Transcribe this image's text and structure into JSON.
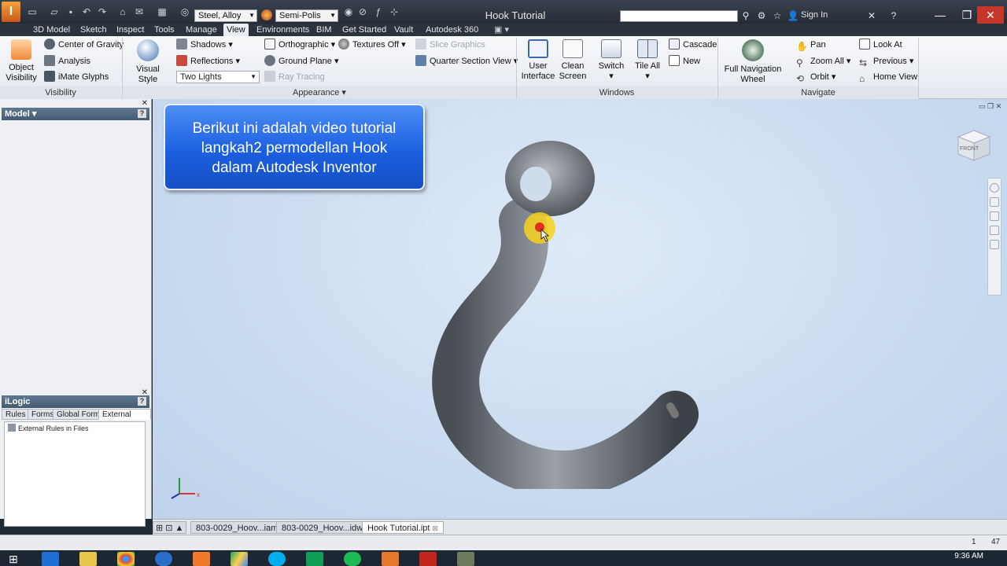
{
  "titlebar": {
    "material": "Steel, Alloy",
    "appearance": "Semi-Polis",
    "title": "Hook Tutorial",
    "signin": "Sign In"
  },
  "menu_tabs": [
    "3D Model",
    "Sketch",
    "Inspect",
    "Tools",
    "Manage",
    "View",
    "Environments",
    "BIM",
    "Get Started",
    "Vault",
    "Autodesk 360"
  ],
  "active_tab": "View",
  "ribbon": {
    "visibility": {
      "object_visibility": "Object Visibility",
      "object_visibility_l1": "Object",
      "object_visibility_l2": "Visibility",
      "center_of_gravity": "Center of Gravity",
      "analysis": "Analysis",
      "imate_glyphs": "iMate Glyphs",
      "panel_label": "Visibility"
    },
    "appearance": {
      "visual_style": "Visual Style",
      "shadows": "Shadows",
      "reflections": "Reflections",
      "lighting": "Two Lights",
      "orthographic": "Orthographic",
      "ground_plane": "Ground Plane",
      "ray_tracing": "Ray Tracing",
      "textures": "Textures Off",
      "slice_graphics": "Slice Graphics",
      "quarter_section": "Quarter Section View",
      "panel_label": "Appearance"
    },
    "windows": {
      "user_interface_l1": "User",
      "user_interface_l2": "Interface",
      "clean_screen_l1": "Clean",
      "clean_screen_l2": "Screen",
      "switch": "Switch",
      "tile_all": "Tile All",
      "cascade": "Cascade",
      "new": "New",
      "panel_label": "Windows"
    },
    "navigate": {
      "full_nav_wheel_l1": "Full Navigation",
      "full_nav_wheel_l2": "Wheel",
      "pan": "Pan",
      "zoom_all": "Zoom All",
      "orbit": "Orbit",
      "look_at": "Look At",
      "previous": "Previous",
      "home_view": "Home View",
      "panel_label": "Navigate"
    }
  },
  "model_panel": {
    "title": "Model"
  },
  "ilogic_panel": {
    "title": "iLogic",
    "tabs": [
      "Rules",
      "Forms",
      "Global Forms",
      "External Rules"
    ],
    "tree_item": "External Rules in Files"
  },
  "viewport": {
    "banner_lines": [
      "Berikut ini adalah video tutorial",
      "langkah2 permodellan Hook",
      "dalam Autodesk Inventor"
    ],
    "viewcube_label": "FRONT"
  },
  "doc_tabs": [
    "803-0029_Hoov...iam",
    "803-0029_Hoov...idw",
    "Hook Tutorial.ipt"
  ],
  "status": {
    "left_num": "1",
    "right_num": "47"
  },
  "taskbar": {
    "time": "9:36 AM"
  }
}
